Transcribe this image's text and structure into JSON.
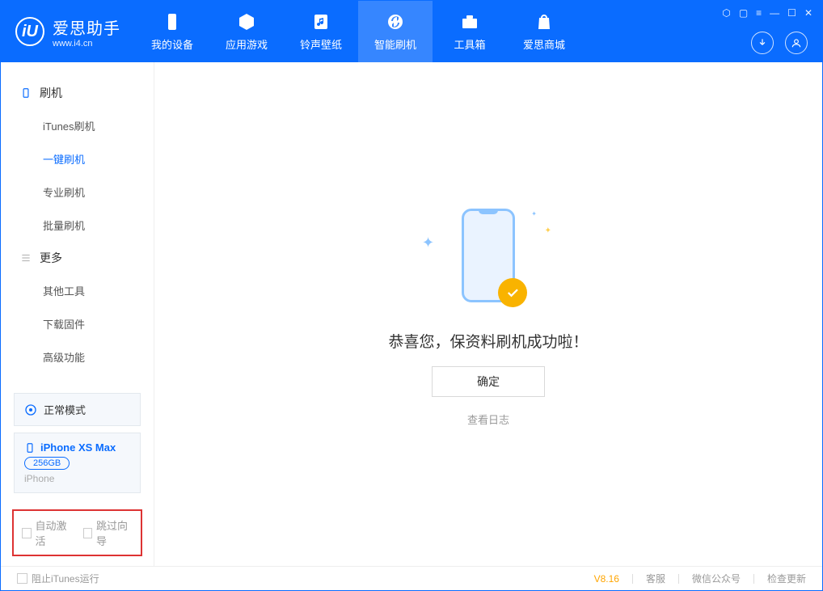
{
  "logo": {
    "title": "爱思助手",
    "sub": "www.i4.cn",
    "mark": "iU"
  },
  "nav": {
    "device": "我的设备",
    "apps": "应用游戏",
    "ring": "铃声壁纸",
    "flash": "智能刷机",
    "tools": "工具箱",
    "store": "爱思商城"
  },
  "sidebar": {
    "section1": "刷机",
    "items1": [
      "iTunes刷机",
      "一键刷机",
      "专业刷机",
      "批量刷机"
    ],
    "section2": "更多",
    "items2": [
      "其他工具",
      "下载固件",
      "高级功能"
    ],
    "status": "正常模式",
    "device_name": "iPhone XS Max",
    "device_storage": "256GB",
    "device_type": "iPhone",
    "cb_auto": "自动激活",
    "cb_skip": "跳过向导"
  },
  "main": {
    "success": "恭喜您，保资料刷机成功啦！",
    "ok": "确定",
    "logs": "查看日志"
  },
  "footer": {
    "block_itunes": "阻止iTunes运行",
    "version": "V8.16",
    "service": "客服",
    "wechat": "微信公众号",
    "update": "检查更新"
  }
}
